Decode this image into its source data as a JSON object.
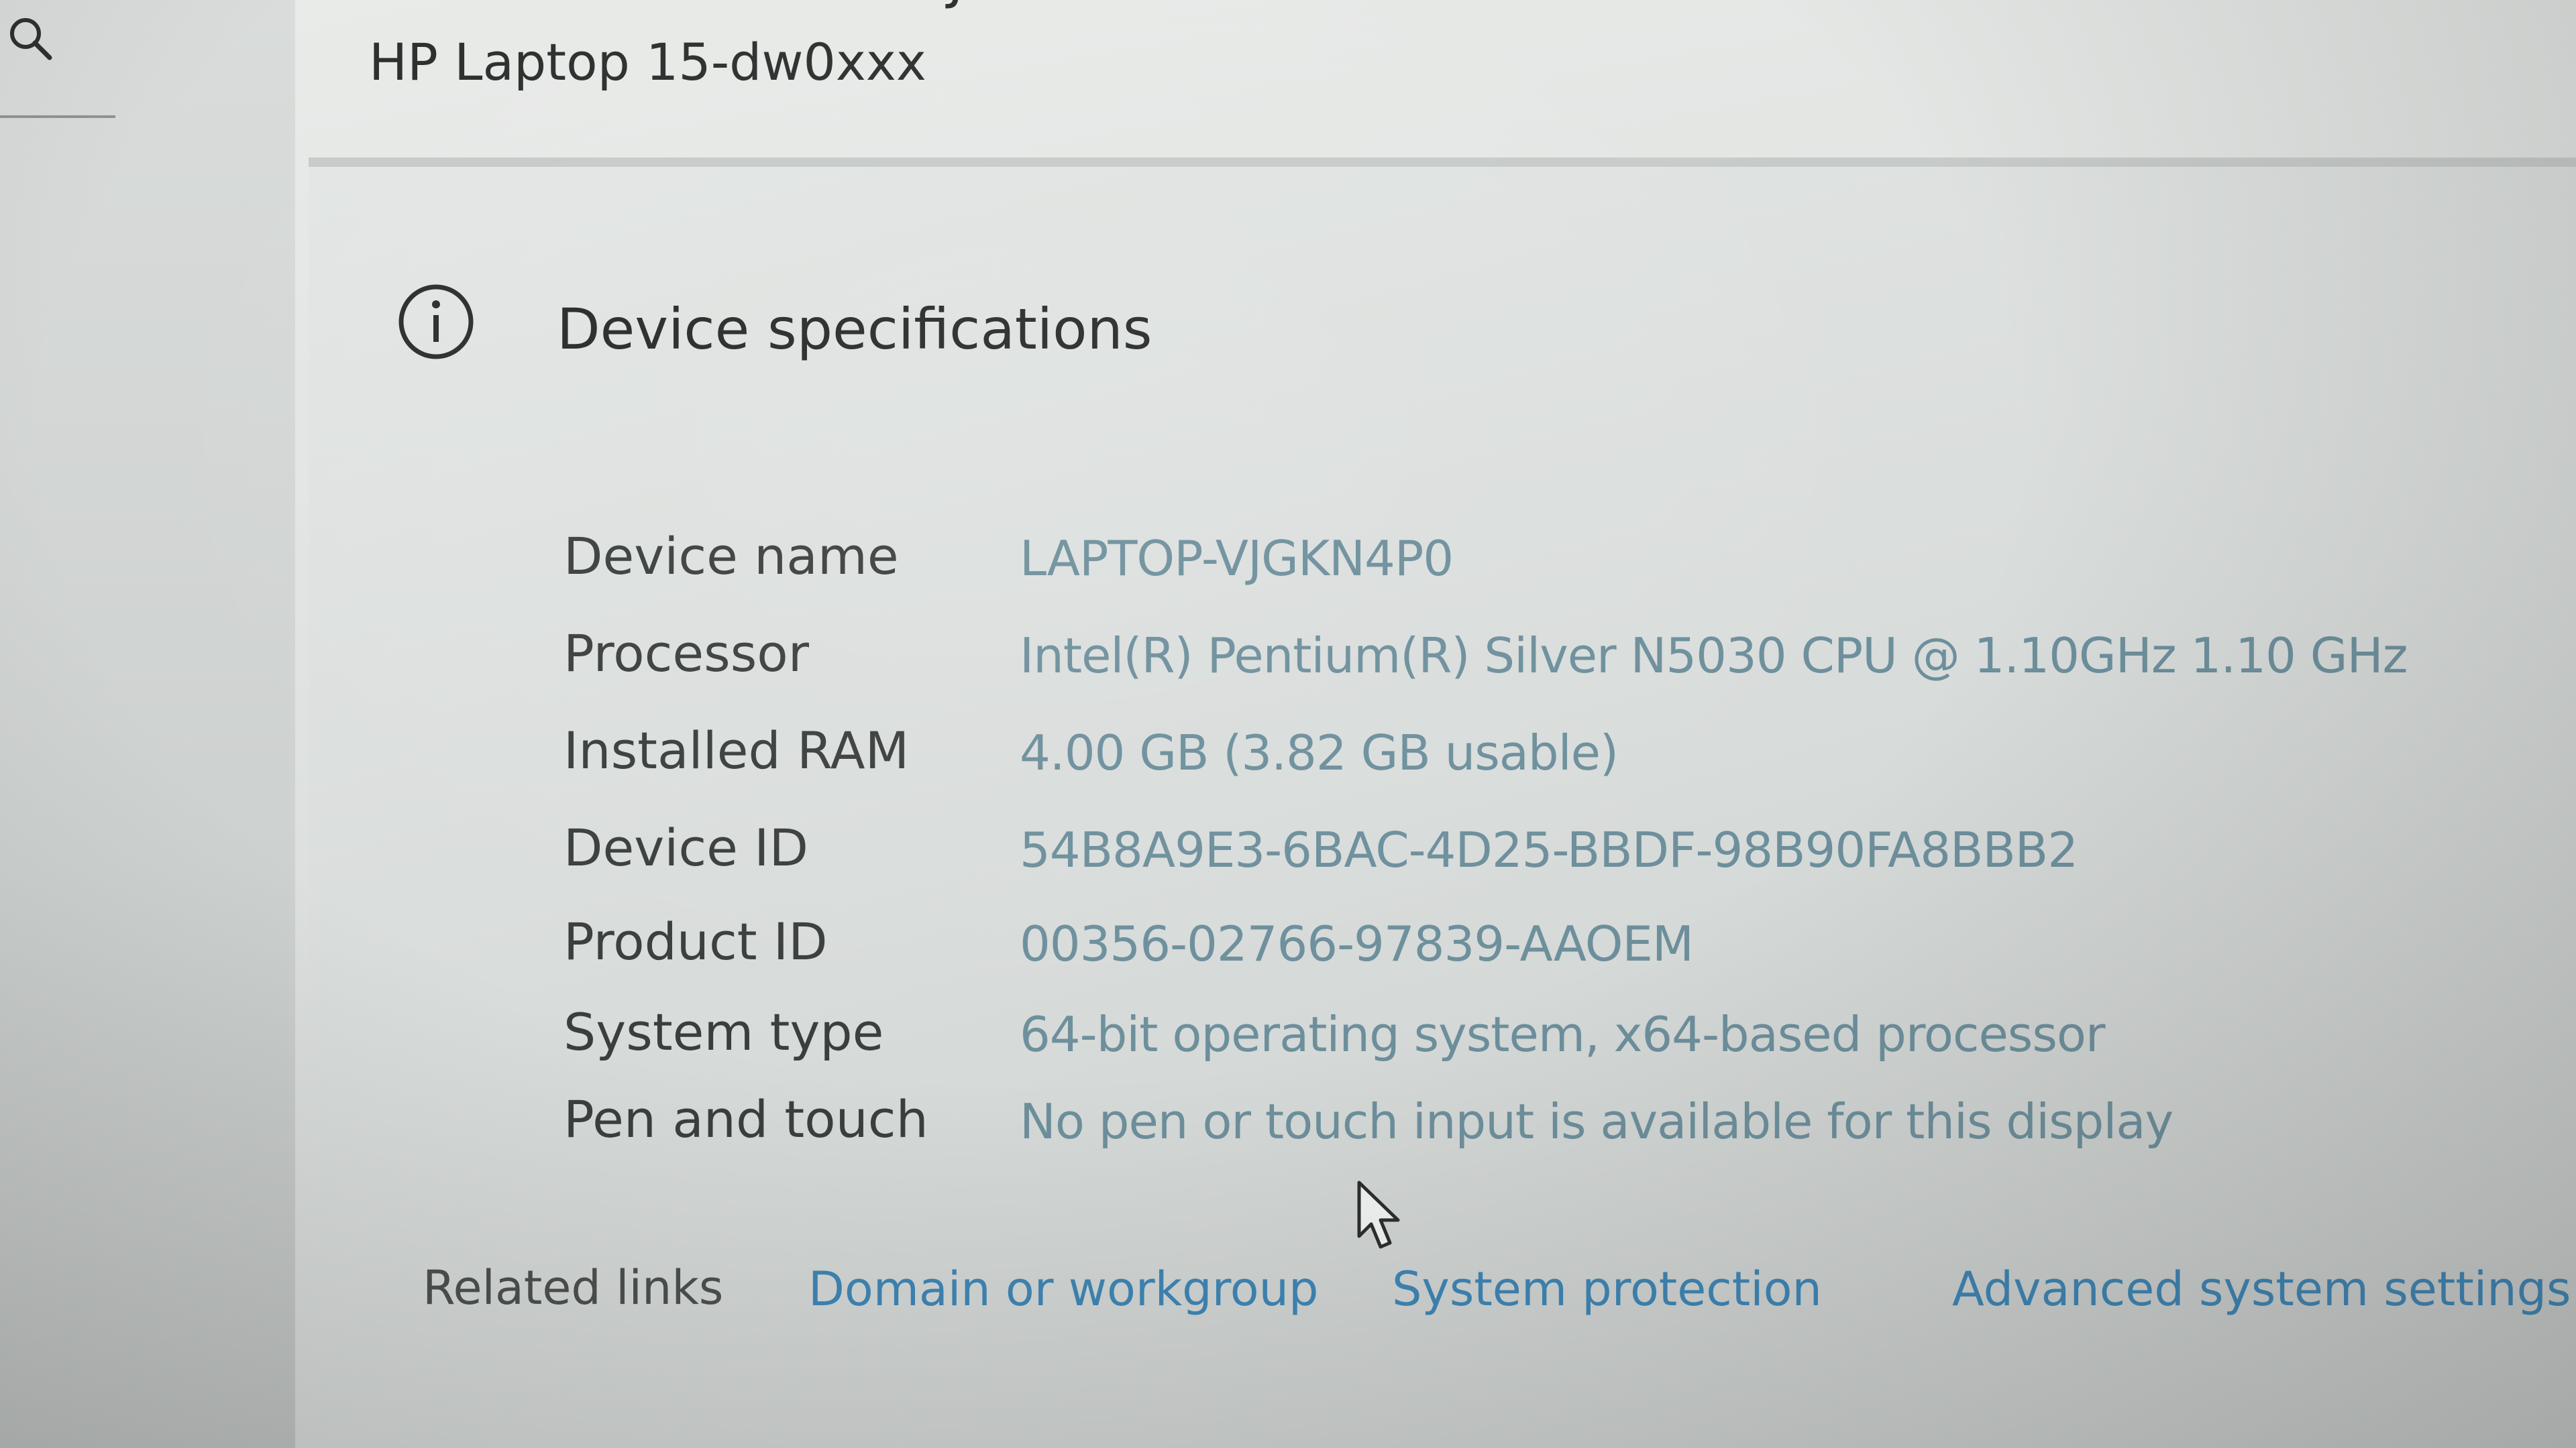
{
  "header": {
    "device_name_cut": "VJGKN4P0",
    "model": "HP Laptop 15-dw0xxx"
  },
  "section": {
    "title": "Device specifications"
  },
  "specs": [
    {
      "label": "Device name",
      "value": "LAPTOP-VJGKN4P0"
    },
    {
      "label": "Processor",
      "value": "Intel(R) Pentium(R) Silver N5030 CPU @ 1.10GHz   1.10 GHz"
    },
    {
      "label": "Installed RAM",
      "value": "4.00 GB (3.82 GB usable)"
    },
    {
      "label": "Device ID",
      "value": "54B8A9E3-6BAC-4D25-BBDF-98B90FA8BBB2"
    },
    {
      "label": "Product ID",
      "value": "00356-02766-97839-AAOEM"
    },
    {
      "label": "System type",
      "value": "64-bit operating system, x64-based processor"
    },
    {
      "label": "Pen and touch",
      "value": "No pen or touch input is available for this display"
    }
  ],
  "related": {
    "label": "Related links",
    "links": [
      "Domain or workgroup",
      "System protection",
      "Advanced system settings"
    ]
  },
  "icons": {
    "search": "search-icon",
    "info": "info-icon",
    "cursor": "mouse-cursor-icon"
  },
  "colors": {
    "value_text": "#6d8f9c",
    "link": "#3d85b5"
  }
}
